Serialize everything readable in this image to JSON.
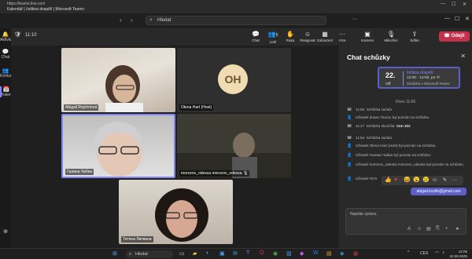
{
  "browser": {
    "url": "https://teams.live.com",
    "window_title": "Kalendář | čeština dospělí | Microsoft Teams"
  },
  "titlebar": {
    "search_placeholder": "Hledat",
    "more": "···"
  },
  "rail": [
    {
      "icon": "bell-icon",
      "label": "Aktivita",
      "glyph": "🔔"
    },
    {
      "icon": "chat-icon",
      "label": "Chat",
      "glyph": "💬"
    },
    {
      "icon": "people-icon",
      "label": "Komunity",
      "glyph": "👥"
    },
    {
      "icon": "calendar-icon",
      "label": "Kalendář",
      "glyph": "📅"
    },
    {
      "icon": "apps-icon",
      "label": "",
      "glyph": "⊕"
    }
  ],
  "meeting_toolbar": {
    "timer": "11:10",
    "tools": [
      {
        "name": "chat",
        "label": "Chat",
        "glyph": "💬"
      },
      {
        "name": "people",
        "label": "Lidé",
        "glyph": "👥",
        "count": "5"
      },
      {
        "name": "raise-hand",
        "label": "Ruka",
        "glyph": "✋"
      },
      {
        "name": "react",
        "label": "Reagovat",
        "glyph": "☺"
      },
      {
        "name": "view",
        "label": "Zobrazení",
        "glyph": "▦"
      },
      {
        "name": "more",
        "label": "Více",
        "glyph": "···"
      },
      {
        "name": "camera",
        "label": "Kamera",
        "glyph": "▣"
      },
      {
        "name": "mic",
        "label": "Mikrofon",
        "glyph": "🎙"
      },
      {
        "name": "share",
        "label": "Sdílet",
        "glyph": "⇪"
      }
    ],
    "leave_label": "Odejít"
  },
  "participants": [
    {
      "name": "Abigail Rejchrtová",
      "initials": ""
    },
    {
      "name": "Olena Hart (Host)",
      "initials": "OH"
    },
    {
      "name": "Галина Чабан",
      "initials": ""
    },
    {
      "name": "morozov_odessa morozov_odessa",
      "initials": ""
    },
    {
      "name": "Тетяна Литвина",
      "initials": ""
    }
  ],
  "chat": {
    "title": "Chat schůzky",
    "event": {
      "day": "22.",
      "month": "zář",
      "title": "čeština dospělí",
      "time": "12:00 - 13:00, po",
      "sub": "Schůzka v Microsoft Teams"
    },
    "date_header": "Dnes 11:06",
    "messages": [
      {
        "time": "11:06",
        "text": "Schůzka začala",
        "icon": "phone-icon",
        "bold": ""
      },
      {
        "time": "",
        "text": "Uživatel dusan Tkuroc byl pozván na schůzku.",
        "icon": "people-icon",
        "bold": ""
      },
      {
        "time": "11:17",
        "text": "Schůzka skončila:",
        "icon": "phone-icon",
        "bold": "11m 33s"
      },
      {
        "time": "11:54",
        "text": "Schůzka začala",
        "icon": "phone-icon",
        "bold": ""
      },
      {
        "time": "",
        "text": "Uživatel Olena Hart (Host) byl pozván na schůzku.",
        "icon": "people-icon",
        "bold": ""
      },
      {
        "time": "",
        "text": "Uživatel Галина Чабан byl pozván na schůzku.",
        "icon": "people-icon",
        "bold": ""
      },
      {
        "time": "",
        "text": "Uživatel morozov_odessa morozov_odessa byl pozván na schůzku.",
        "icon": "people-icon",
        "bold": ""
      },
      {
        "time": "",
        "text": "Uživatel Тетя",
        "icon": "people-icon",
        "bold": ""
      }
    ],
    "own_message": "abigail.kozlik@gmail.com",
    "compose_placeholder": "Napište zprávu."
  },
  "taskbar": {
    "search": "Hledat",
    "lang": "CES",
    "time": "12:05",
    "date": "22.09.2025"
  }
}
